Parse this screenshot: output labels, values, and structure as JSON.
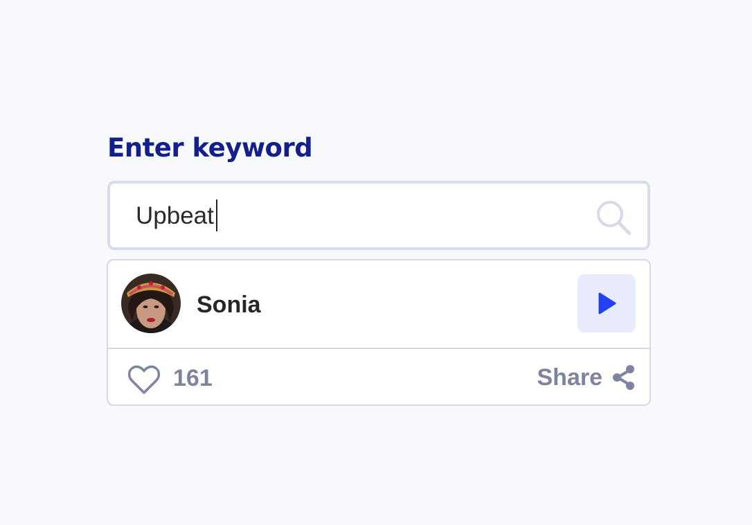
{
  "heading": "Enter keyword",
  "search": {
    "value": "Upbeat",
    "icon": "search-icon"
  },
  "result": {
    "name": "Sonia",
    "avatar_icon": "avatar-photo",
    "play_icon": "play-icon",
    "likes": "161",
    "share_label": "Share",
    "share_icon": "share-icon",
    "heart_icon": "heart-outline-icon"
  },
  "colors": {
    "heading": "#13208b",
    "accent": "#2340f2",
    "play_bg": "#e9ecff",
    "muted": "#7e849e",
    "border": "#d9dcec",
    "background": "#f8f9fc"
  }
}
